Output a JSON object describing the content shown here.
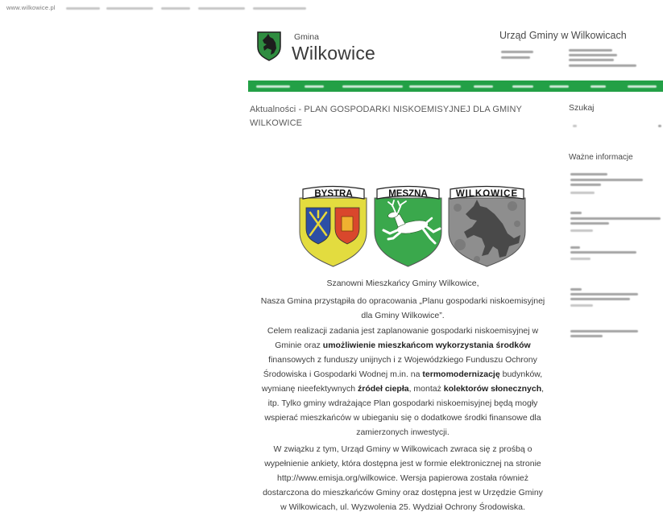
{
  "browser": {
    "url": "www.wilkowice.pl"
  },
  "header": {
    "logo_icon": "coat-of-arms-icon",
    "brand_small": "Gmina",
    "brand_large": "Wilkowice",
    "office_name": "Urząd Gminy w Wilkowicach"
  },
  "colors": {
    "nav_bar": "#23a046",
    "shield_bystra": "#e3dc3f",
    "shield_meszna": "#3aa84c",
    "shield_wilkowice": "#8e8e8e",
    "body_text": "#3d3d3d"
  },
  "main": {
    "heading": "Aktualności - PLAN GOSPODARKI NISKOEMISYJNEJ DLA GMINY WILKOWICE",
    "coats": [
      {
        "label": "BYSTRA"
      },
      {
        "label": "MESZNA"
      },
      {
        "label": "WILKOWICE"
      }
    ],
    "greeting": "Szanowni Mieszkańcy Gminy Wilkowice,",
    "intro": [
      "Nasza Gmina przystąpiła do opracowania „Planu gospodarki niskoemisyjnej",
      "dla Gminy Wilkowice”."
    ],
    "paragraph1": [
      [
        {
          "t": "Celem realizacji zadania jest zaplanowanie gospodarki niskoemisyjnej w"
        }
      ],
      [
        {
          "t": "Gminie oraz "
        },
        {
          "t": "umożliwienie mieszkańcom wykorzystania środków",
          "b": true
        }
      ],
      [
        {
          "t": "finansowych z funduszy unijnych i z Wojewódzkiego Funduszu Ochrony"
        }
      ],
      [
        {
          "t": "Środowiska i Gospodarki Wodnej m.in. na "
        },
        {
          "t": "termomodernizację",
          "b": true
        },
        {
          "t": " budynków,"
        }
      ],
      [
        {
          "t": "wymianę nieefektywnych "
        },
        {
          "t": "źródeł ciepła",
          "b": true
        },
        {
          "t": ", montaż "
        },
        {
          "t": "kolektorów słonecznych",
          "b": true
        },
        {
          "t": ","
        }
      ],
      [
        {
          "t": "itp. Tylko gminy wdrażające Plan gospodarki niskoemisyjnej będą mogły"
        }
      ],
      [
        {
          "t": "wspierać mieszkańców w ubieganiu się o dodatkowe środki finansowe dla"
        }
      ],
      [
        {
          "t": "zamierzonych inwestycji."
        }
      ]
    ],
    "paragraph2": [
      "W związku z tym, Urząd Gminy w Wilkowicach zwraca się z prośbą o",
      "wypełnienie ankiety, która dostępna jest w formie elektronicznej na stronie",
      "http://www.emisja.org/wilkowice. Wersja papierowa została również",
      "dostarczona do mieszkańców Gminy oraz dostępna jest w Urzędzie Gminy",
      "w Wilkowicach, ul. Wyzwolenia 25. Wydział Ochrony Środowiska."
    ]
  },
  "sidebar": {
    "search_title": "Szukaj",
    "info_title": "Ważne informacje"
  }
}
